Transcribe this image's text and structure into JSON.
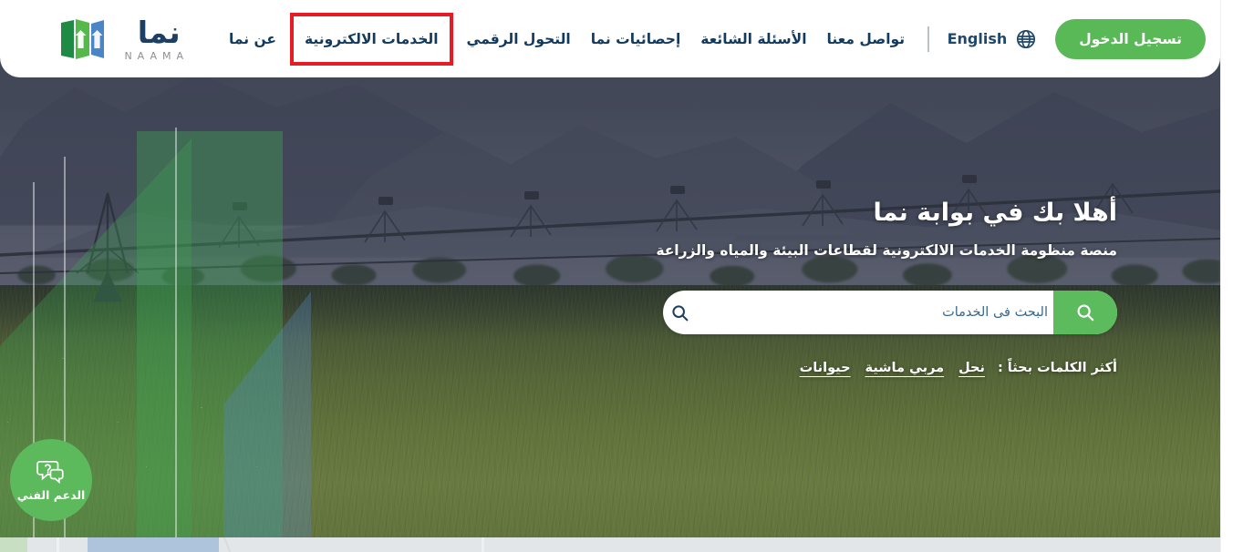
{
  "brand": {
    "logo_arabic": "نما",
    "logo_latin": "NAAMA",
    "logo_mark_name": "naama-arrows-mark",
    "colors": {
      "navy": "#123a5e",
      "green": "#58b956",
      "light_green": "#6cc24a",
      "blue": "#4a7fc1",
      "highlight_red": "#e71c22"
    }
  },
  "navbar": {
    "links": [
      {
        "label": "عن نما",
        "name": "about",
        "highlighted": false
      },
      {
        "label": "الخدمات الالكترونية",
        "name": "e-services",
        "highlighted": true
      },
      {
        "label": "التحول الرقمي",
        "name": "digital-transformation",
        "highlighted": false
      },
      {
        "label": "إحصائيات نما",
        "name": "naama-statistics",
        "highlighted": false
      },
      {
        "label": "الأسئلة الشائعة",
        "name": "faq",
        "highlighted": false
      },
      {
        "label": "تواصل معنا",
        "name": "contact-us",
        "highlighted": false
      }
    ],
    "language_switch": {
      "label": "English",
      "icon": "globe-icon"
    },
    "login_button": "تسجيل الدخول"
  },
  "hero": {
    "title": "أهلا بك في بوابة نما",
    "subtitle": "منصة منظومة الخدمات الالكترونية لقطاعات البيئة والمياه والزراعة",
    "search": {
      "placeholder": "البحث فى الخدمات",
      "value": "",
      "field_icon": "search-icon",
      "submit_icon": "search-icon"
    },
    "keywords": {
      "label": "أكثر الكلمات بحثاً :",
      "items": [
        "نحل",
        "مربي ماشية",
        "حيوانات"
      ]
    }
  },
  "support": {
    "label": "الدعم الفني",
    "icon": "chat-question-icon"
  }
}
